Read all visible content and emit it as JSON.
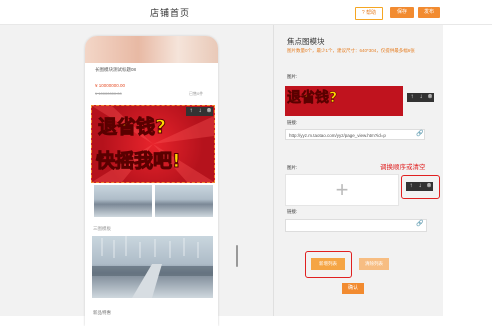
{
  "header": {
    "title": "店铺首页",
    "help_label": "? 帮助",
    "save_label": "保存",
    "publish_label": "发布"
  },
  "phone": {
    "product_title": "长图模块测试标题08",
    "price": "¥ 10000000.00",
    "old_price": "¥ 10000000.00",
    "stock_text": "已售0件",
    "banner": {
      "line1": "退省钱?",
      "line2": "快摇我吧!"
    },
    "section_label": "三图模板",
    "bottom_label": "新品特惠"
  },
  "panel": {
    "title": "焦点图模块",
    "hint": "图片数量0个，最少1个，建议尺寸：640*304，仅提供最多幅6张",
    "image_label": "图片:",
    "link_label": "链接:",
    "link_value": "http://yyz.m.taotao.com/yyz/page_view.htm?id=p",
    "image2_label": "图片:",
    "link2_label": "链接:",
    "annotation": "调换顺序或清空",
    "add_button": "新增列表",
    "clear_button": "清除列表",
    "ok_button": "确认"
  },
  "icons": {
    "up": "arrow-up-icon",
    "down": "arrow-down-icon",
    "remove": "remove-icon",
    "link": "link-icon",
    "plus": "plus-icon"
  },
  "colors": {
    "accent": "#f28b30",
    "annotation_red": "#e02020",
    "banner_red": "#c8141f",
    "banner_yellow": "#ffd800"
  }
}
